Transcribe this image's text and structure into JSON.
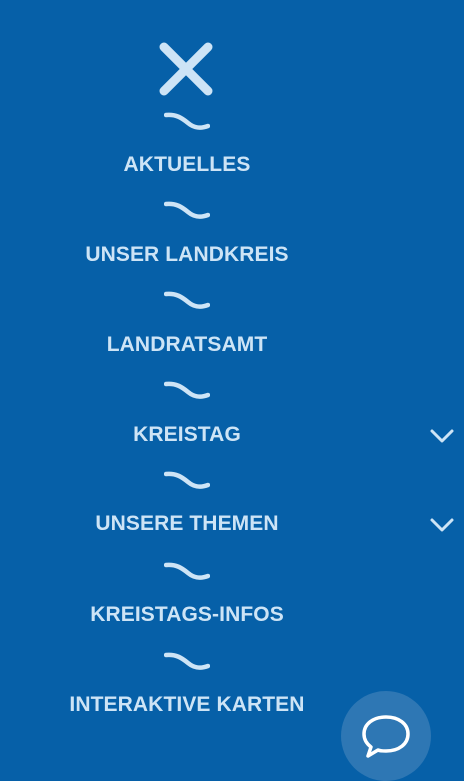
{
  "menu": {
    "close_icon": "close-icon",
    "separator_icon": "wave-separator-icon",
    "items": [
      {
        "label": "AKTUELLES",
        "has_submenu": false
      },
      {
        "label": "UNSER LANDKREIS",
        "has_submenu": false
      },
      {
        "label": "LANDRATSAMT",
        "has_submenu": false
      },
      {
        "label": "KREISTAG",
        "has_submenu": true
      },
      {
        "label": "UNSERE THEMEN",
        "has_submenu": true
      },
      {
        "label": "KREISTAGS-INFOS",
        "has_submenu": false
      },
      {
        "label": "INTERAKTIVE KARTEN",
        "has_submenu": false
      }
    ],
    "submenu_icon": "chevron-down-icon",
    "chat_icon": "chat-bubble-icon"
  },
  "colors": {
    "background": "#0660a8",
    "text": "#cde4f6",
    "icon": "#cde4f6",
    "chat_button": "#2e77b4"
  }
}
